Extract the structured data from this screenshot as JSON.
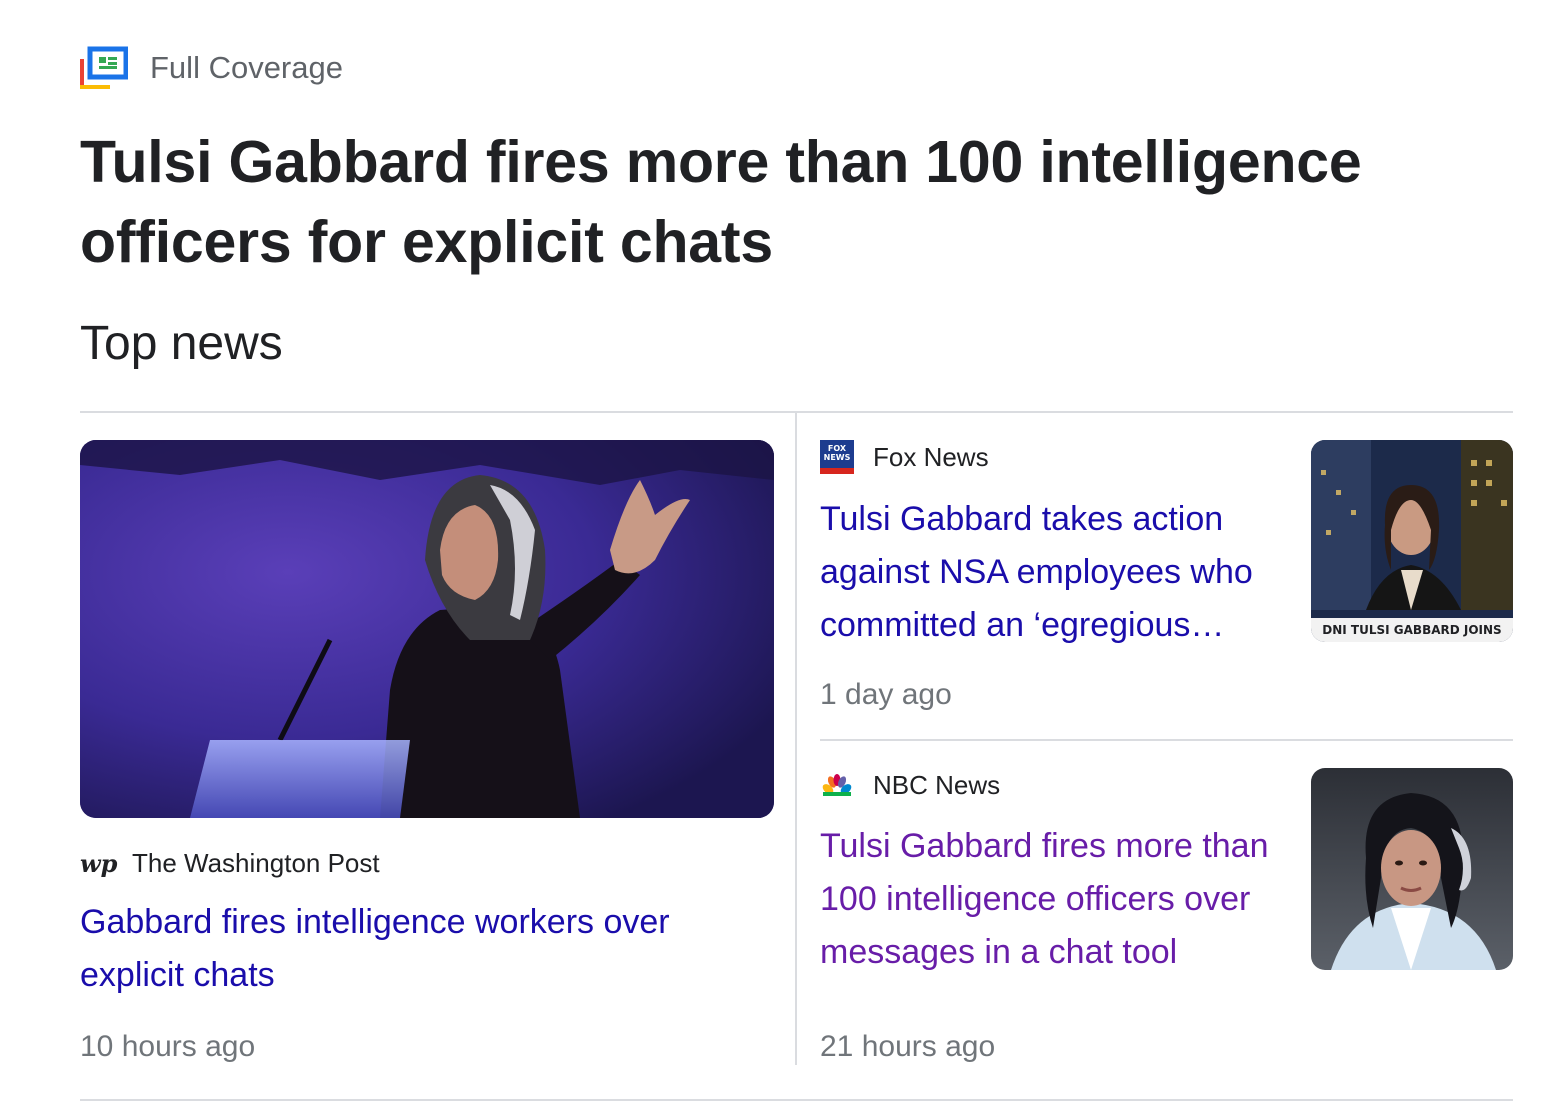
{
  "header": {
    "label": "Full Coverage"
  },
  "story": {
    "title": "Tulsi Gabbard fires more than 100 intelligence officers for explicit chats"
  },
  "section": {
    "title": "Top news"
  },
  "articles": [
    {
      "source": "The Washington Post",
      "source_logo_text": "wp",
      "headline": "Gabbard fires intelligence workers over explicit chats",
      "time": "10 hours ago"
    },
    {
      "source": "Fox News",
      "source_logo_text": "FOX NEWS",
      "headline": "Tulsi Gabbard takes action against NSA employees who committed an ‘egregious…",
      "time": "1 day ago",
      "thumb_caption": "DNI TULSI GABBARD JOINS"
    },
    {
      "source": "NBC News",
      "headline": "Tulsi Gabbard fires more than 100 intelligence officers over messages in a chat tool",
      "time": "21 hours ago",
      "visited": true
    }
  ],
  "colors": {
    "link": "#1a0dab",
    "visited_link": "#681da8",
    "muted": "#70757a"
  }
}
